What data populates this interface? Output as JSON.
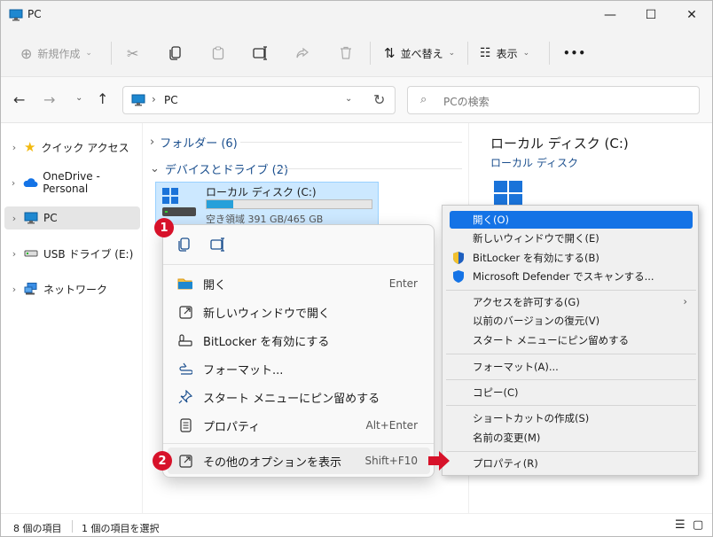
{
  "window": {
    "title": "PC",
    "controls": [
      "minimize",
      "maximize",
      "close"
    ]
  },
  "toolbar": {
    "new_label": "新規作成",
    "sort_label": "並べ替え",
    "view_label": "表示",
    "more_label": "•••"
  },
  "nav": {
    "breadcrumb_sep": "›",
    "location": "PC",
    "search_placeholder": "PCの検索"
  },
  "sidebar": {
    "items": [
      {
        "label": "クイック アクセス",
        "icon": "star-icon"
      },
      {
        "label": "OneDrive - Personal",
        "icon": "cloud-icon"
      },
      {
        "label": "PC",
        "icon": "monitor-icon",
        "selected": true
      },
      {
        "label": "USB ドライブ (E:)",
        "icon": "usb-drive-icon"
      },
      {
        "label": "ネットワーク",
        "icon": "network-icon"
      }
    ]
  },
  "main": {
    "group_folders": "フォルダー (6)",
    "group_drives": "デバイスとドライブ (2)",
    "drive": {
      "name": "ローカル ディスク (C:)",
      "space": "空き領域 391 GB/465 GB",
      "used_fraction": 0.16
    }
  },
  "details": {
    "title": "ローカル ディスク (C:)",
    "subtitle": "ローカル ディスク"
  },
  "context_menu": {
    "badge1": "1",
    "badge2": "2",
    "items": [
      {
        "label": "開く",
        "shortcut": "Enter",
        "icon": "folder-open-icon"
      },
      {
        "label": "新しいウィンドウで開く",
        "shortcut": "",
        "icon": "open-new-window-icon"
      },
      {
        "label": "BitLocker を有効にする",
        "shortcut": "",
        "icon": "key-icon"
      },
      {
        "label": "フォーマット...",
        "shortcut": "",
        "icon": "format-icon"
      },
      {
        "label": "スタート メニューにピン留めする",
        "shortcut": "",
        "icon": "pin-icon"
      },
      {
        "label": "プロパティ",
        "shortcut": "Alt+Enter",
        "icon": "properties-icon"
      }
    ],
    "more": {
      "label": "その他のオプションを表示",
      "shortcut": "Shift+F10",
      "icon": "more-options-icon"
    }
  },
  "classic_menu": {
    "items": [
      "開く(O)",
      "新しいウィンドウで開く(E)",
      "BitLocker を有効にする(B)",
      "Microsoft Defender でスキャンする...",
      "アクセスを許可する(G)",
      "以前のバージョンの復元(V)",
      "スタート メニューにピン留めする",
      "フォーマット(A)...",
      "コピー(C)",
      "ショートカットの作成(S)",
      "名前の変更(M)",
      "プロパティ(R)"
    ]
  },
  "status": {
    "count": "8 個の項目",
    "selected": "1 個の項目を選択"
  },
  "colors": {
    "accent": "#1473e6",
    "badge": "#d7122a",
    "arrow": "#d7122a",
    "progress": "#26a0da"
  }
}
